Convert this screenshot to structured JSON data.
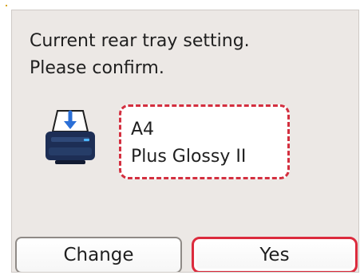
{
  "dialog": {
    "message_line_1": "Current rear tray setting.",
    "message_line_2": "Please confirm."
  },
  "paper_setting": {
    "size": "A4",
    "media_type": "Plus Glossy II"
  },
  "buttons": {
    "change_label": "Change",
    "yes_label": "Yes"
  },
  "icons": {
    "printer": "printer-rear-tray-icon"
  },
  "colors": {
    "screen_background": "#ece8e5",
    "highlight_red": "#d32f3f",
    "printer_blue": "#2b6fd6",
    "printer_dark": "#1d2e55"
  }
}
